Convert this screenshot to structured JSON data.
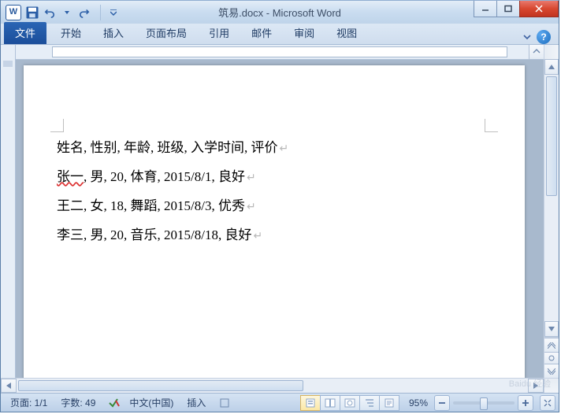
{
  "title": "筑易.docx - Microsoft Word",
  "ribbon": {
    "file": "文件",
    "tabs": [
      "开始",
      "插入",
      "页面布局",
      "引用",
      "邮件",
      "审阅",
      "视图"
    ]
  },
  "document": {
    "lines": [
      "姓名, 性别, 年龄, 班级, 入学时间, 评价",
      "张一, 男, 20, 体育, 2015/8/1, 良好",
      "王二, 女, 18, 舞蹈, 2015/8/3, 优秀",
      "李三, 男, 20, 音乐, 2015/8/18, 良好"
    ]
  },
  "status": {
    "page": "页面: 1/1",
    "words": "字数: 49",
    "lang": "中文(中国)",
    "mode": "插入",
    "zoom": "95%"
  },
  "watermark": "Baidu 经验"
}
